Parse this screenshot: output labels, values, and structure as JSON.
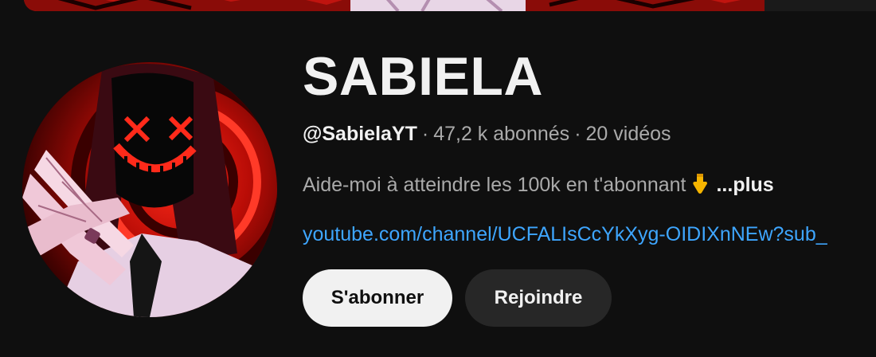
{
  "channel": {
    "name": "SABIELA",
    "handle": "@SabielaYT",
    "separator": "·",
    "subscribers": "47,2 k abonnés",
    "videos": "20 vidéos",
    "description": "Aide-moi à atteindre les 100k en t'abonnant",
    "description_emoji": "pointing-down-hand-icon",
    "more_label": "...plus",
    "link": "youtube.com/channel/UCFALIsCcYkXyg-OIDIXnNEw?sub_"
  },
  "actions": {
    "subscribe_label": "S'abonner",
    "join_label": "Rejoindre"
  },
  "colors": {
    "background": "#0f0f0f",
    "primary_text": "#f1f1f1",
    "secondary_text": "#aaaaaa",
    "link": "#3ea6ff",
    "subscribe_bg": "#f1f1f1",
    "join_bg": "#272727",
    "banner_red": "#c0140f"
  }
}
